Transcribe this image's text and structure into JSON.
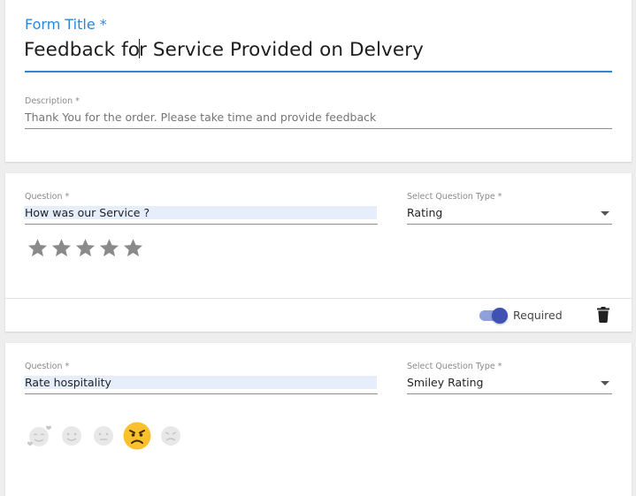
{
  "form": {
    "title_label": "Form Title *",
    "title_value_before": "Feedback fo",
    "title_value_after": "r Service Provided on Delvery",
    "description_label": "Description *",
    "description_value": "Thank You for the order. Please take time and provide feedback"
  },
  "questions": [
    {
      "question_label": "Question *",
      "question_value": "How was our Service ?",
      "type_label": "Select Question Type *",
      "type_value": "Rating",
      "star_count": 5,
      "required_label": "Required",
      "required_on": true
    },
    {
      "question_label": "Question *",
      "question_value": "Rate hospitality",
      "type_label": "Select Question Type *",
      "type_value": "Smiley Rating",
      "smileys": [
        "in-love-smiley-icon",
        "happy-smiley-icon",
        "neutral-smiley-icon",
        "angry-smiley-icon",
        "crying-smiley-icon"
      ],
      "selected_smiley": 3
    }
  ],
  "colors": {
    "accent": "#2f86d6",
    "toggle_thumb": "#3f51b5",
    "toggle_track": "#8fa0da",
    "star": "#8a8a8a",
    "smiley_selected": "#fbc02d",
    "field_highlight": "#e6eefb"
  }
}
